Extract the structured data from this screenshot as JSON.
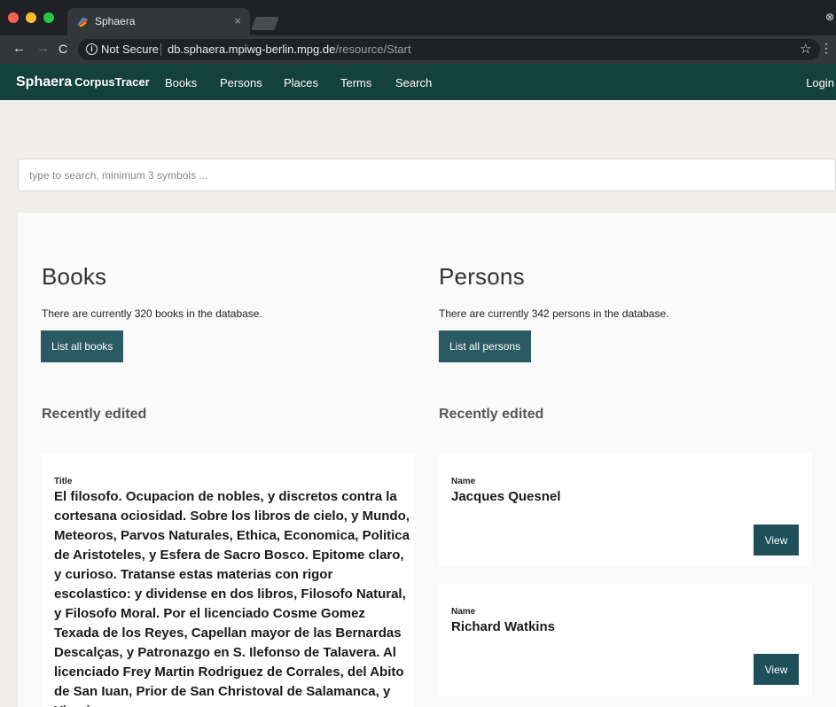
{
  "browser": {
    "tab_title": "Sphaera",
    "tab_close": "×",
    "not_secure": "Not Secure",
    "url_host": "db.sphaera.mpiwg-berlin.mpg.de",
    "url_path": "/resource/Start"
  },
  "navbar": {
    "brand": "Sphaera",
    "brand_sub": "CorpusTracer",
    "links": [
      "Books",
      "Persons",
      "Places",
      "Terms",
      "Search"
    ],
    "login": "Login",
    "background": "#14403e"
  },
  "search": {
    "placeholder": "type to search, minimum 3 symbols ..."
  },
  "books": {
    "heading": "Books",
    "count_text": "There are currently 320 books in the database.",
    "list_button": "List all books",
    "recent_heading": "Recently edited",
    "card": {
      "label": "Title",
      "value": "El filosofo. Ocupacion de nobles, y discretos contra la cortesana ociosidad. Sobre los libros de cielo, y Mundo, Meteoros, Parvos Naturales, Ethica, Economica, Politica de Aristoteles, y Esfera de Sacro Bosco. Epitome claro, y curioso. Tratanse estas materias con rigor escolastico: y dividense en dos libros, Filosofo Natural, y Filosofo Moral. Por el licenciado Cosme Gomez Texada de los Reyes, Capellan mayor de las Bernardas Descalças, y Patronazgo en S. Ilefonso de Talavera. Al licenciado Frey Martin Rodriguez de Corrales, del Abito de San Iuan, Prior de San Christoval de Salamanca, y Vicario"
    }
  },
  "persons": {
    "heading": "Persons",
    "count_text": "There are currently 342 persons in the database.",
    "list_button": "List all persons",
    "recent_heading": "Recently edited",
    "cards": [
      {
        "label": "Name",
        "value": "Jacques Quesnel",
        "button": "View"
      },
      {
        "label": "Name",
        "value": "Richard Watkins",
        "button": "View"
      }
    ]
  },
  "colors": {
    "button": "#2a5a63",
    "view_button": "#1f4f59"
  }
}
